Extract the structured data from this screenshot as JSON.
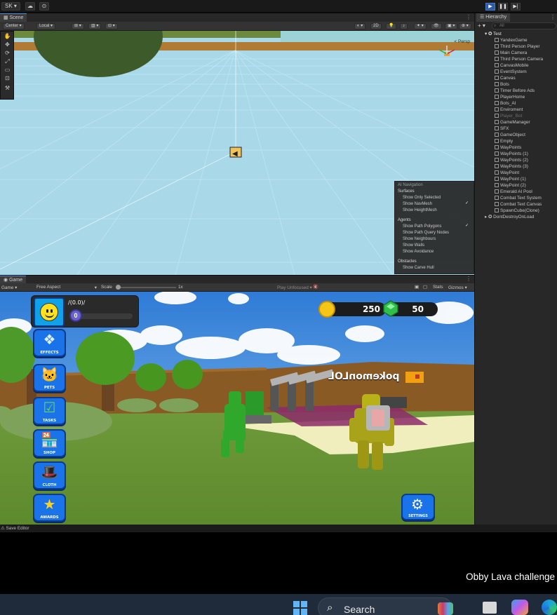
{
  "toolbar": {
    "account_label": "SK ▾",
    "cloud_icon": "cloud-icon",
    "services_icon": "services-icon",
    "play_icon": "play-icon",
    "pause_icon": "pause-icon",
    "step_icon": "step-icon"
  },
  "scene": {
    "tab_label": "Scene",
    "pivot_label": "Center",
    "space_label": "Local",
    "mode_2d": "2D",
    "camera_perspective": "< Persp"
  },
  "navigation_overlay": {
    "title": "AI Navigation",
    "surfaces_header": "Surfaces",
    "surfaces": [
      {
        "label": "Show Only Selected",
        "checked": false
      },
      {
        "label": "Show NavMesh",
        "checked": true
      },
      {
        "label": "Show HeightMesh",
        "checked": false
      }
    ],
    "agents_header": "Agents",
    "agents": [
      {
        "label": "Show Path Polygons",
        "checked": true
      },
      {
        "label": "Show Path Query Nodes",
        "checked": false
      },
      {
        "label": "Show Neighbours",
        "checked": false
      },
      {
        "label": "Show Walls",
        "checked": false
      },
      {
        "label": "Show Avoidance",
        "checked": false
      }
    ],
    "obstacles_header": "Obstacles",
    "obstacles": [
      {
        "label": "Show Carve Hull",
        "checked": false
      }
    ]
  },
  "hierarchy": {
    "tab_label": "Hierarchy",
    "search_placeholder": "All",
    "scene_name": "Test",
    "items": [
      {
        "label": "YandexGame",
        "dim": false
      },
      {
        "label": "Third Person Player",
        "dim": false
      },
      {
        "label": "Main Camera",
        "dim": false
      },
      {
        "label": "Third Person Camera",
        "dim": false
      },
      {
        "label": "CanvasMobile",
        "dim": false
      },
      {
        "label": "EventSystem",
        "dim": false
      },
      {
        "label": "Canvas",
        "dim": false
      },
      {
        "label": "Bots",
        "dim": false
      },
      {
        "label": "Timer Before Ads",
        "dim": false
      },
      {
        "label": "PlayerHome",
        "dim": false
      },
      {
        "label": "Bots_AI",
        "dim": false
      },
      {
        "label": "Enviroment",
        "dim": false
      },
      {
        "label": "Player_Bot",
        "dim": true
      },
      {
        "label": "GameManager",
        "dim": false
      },
      {
        "label": "SFX",
        "dim": false
      },
      {
        "label": "GameObject",
        "dim": false
      },
      {
        "label": "Empty",
        "dim": false
      },
      {
        "label": "WayPoints",
        "dim": false
      },
      {
        "label": "WayPoints (1)",
        "dim": false
      },
      {
        "label": "WayPoints (2)",
        "dim": false
      },
      {
        "label": "WayPoints (3)",
        "dim": false
      },
      {
        "label": "WayPoint",
        "dim": false
      },
      {
        "label": "WayPoint (1)",
        "dim": false
      },
      {
        "label": "WayPoint (2)",
        "dim": false
      },
      {
        "label": "Emerald AI Pool",
        "dim": false
      },
      {
        "label": "Combat Text System",
        "dim": false
      },
      {
        "label": "Combat Text Canvas",
        "dim": false
      },
      {
        "label": "SpawnCube(Clone)",
        "dim": false
      }
    ],
    "dont_destroy": "DontDestroyOnLoad"
  },
  "game": {
    "tab_label": "Game",
    "display_label": "Game",
    "aspect_label": "Free Aspect",
    "scale_label": "Scale",
    "scale_value": "1x",
    "play_mode_label": "Play Unfocused",
    "stats_label": "Stats",
    "gizmos_label": "Gizmos"
  },
  "hud": {
    "player_stat": "/(0.0)/",
    "level": "0",
    "xp_fraction": 0.0,
    "coins": "250",
    "gems": "50",
    "player_name": "pokemonLOL",
    "side_buttons": [
      {
        "label": "EFFECTS",
        "icon": "effects-icon"
      },
      {
        "label": "PETS",
        "icon": "pets-icon"
      },
      {
        "label": "TASKS",
        "icon": "tasks-icon"
      },
      {
        "label": "SHOP",
        "icon": "shop-icon"
      },
      {
        "label": "CLOTH",
        "icon": "cloth-icon"
      },
      {
        "label": "AWARDS",
        "icon": "awards-icon"
      }
    ],
    "settings_label": "SETTINGS"
  },
  "status_bar": {
    "text": "Save Editor"
  },
  "video_caption": "Obby Lava challenge",
  "taskbar": {
    "search_label": "Search",
    "icons": [
      "windows-start-icon",
      "search-icon",
      "widgets-icon",
      "task-view-icon",
      "copilot-icon",
      "edge-icon"
    ]
  },
  "colors": {
    "editor_bg": "#282828",
    "sky_editor": "#a9d8e8",
    "game_sky": "#3b87d9",
    "grass": "#6f9d3a",
    "side_button": "#1a73e8",
    "coin": "#f5c518",
    "gem": "#2fbf4a"
  }
}
